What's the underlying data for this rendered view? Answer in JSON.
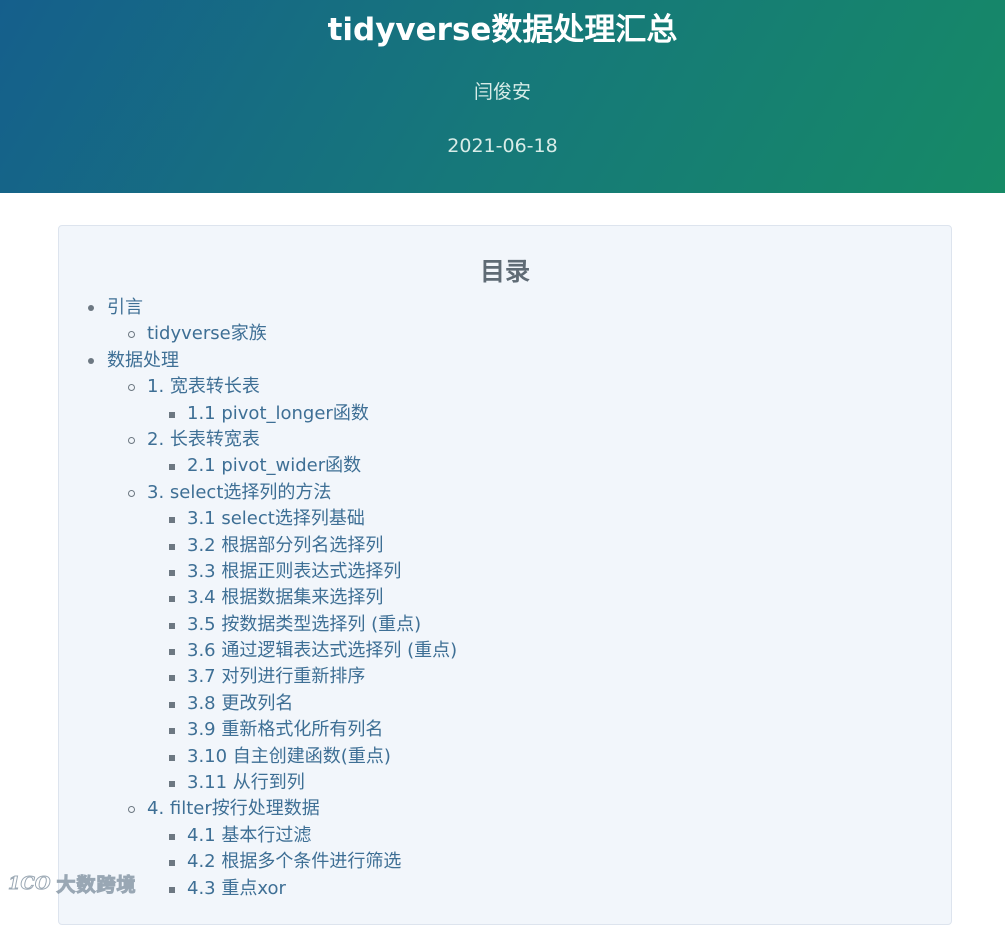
{
  "header": {
    "title": "tidyverse数据处理汇总",
    "author": "闫俊安",
    "date": "2021-06-18"
  },
  "toc": {
    "title": "目录",
    "items": [
      {
        "level": 1,
        "text": "引言"
      },
      {
        "level": 2,
        "text": "tidyverse家族"
      },
      {
        "level": 1,
        "text": "数据处理"
      },
      {
        "level": 2,
        "text": "1. 宽表转长表"
      },
      {
        "level": 3,
        "text": "1.1 pivot_longer函数"
      },
      {
        "level": 2,
        "text": "2. 长表转宽表"
      },
      {
        "level": 3,
        "text": "2.1 pivot_wider函数"
      },
      {
        "level": 2,
        "text": "3. select选择列的方法"
      },
      {
        "level": 3,
        "text": "3.1 select选择列基础"
      },
      {
        "level": 3,
        "text": "3.2 根据部分列名选择列"
      },
      {
        "level": 3,
        "text": "3.3 根据正则表达式选择列"
      },
      {
        "level": 3,
        "text": "3.4 根据数据集来选择列"
      },
      {
        "level": 3,
        "text": "3.5 按数据类型选择列 (重点)"
      },
      {
        "level": 3,
        "text": "3.6 通过逻辑表达式选择列 (重点)"
      },
      {
        "level": 3,
        "text": "3.7 对列进行重新排序"
      },
      {
        "level": 3,
        "text": "3.8 更改列名"
      },
      {
        "level": 3,
        "text": "3.9 重新格式化所有列名"
      },
      {
        "level": 3,
        "text": "3.10 自主创建函数(重点)"
      },
      {
        "level": 3,
        "text": "3.11 从行到列"
      },
      {
        "level": 2,
        "text": "4. filter按行处理数据"
      },
      {
        "level": 3,
        "text": "4.1 基本行过滤"
      },
      {
        "level": 3,
        "text": "4.2 根据多个条件进行筛选"
      },
      {
        "level": 3,
        "text": "4.3 重点xor"
      }
    ]
  },
  "watermark": {
    "logo": "1CO",
    "text": "大数跨境"
  }
}
